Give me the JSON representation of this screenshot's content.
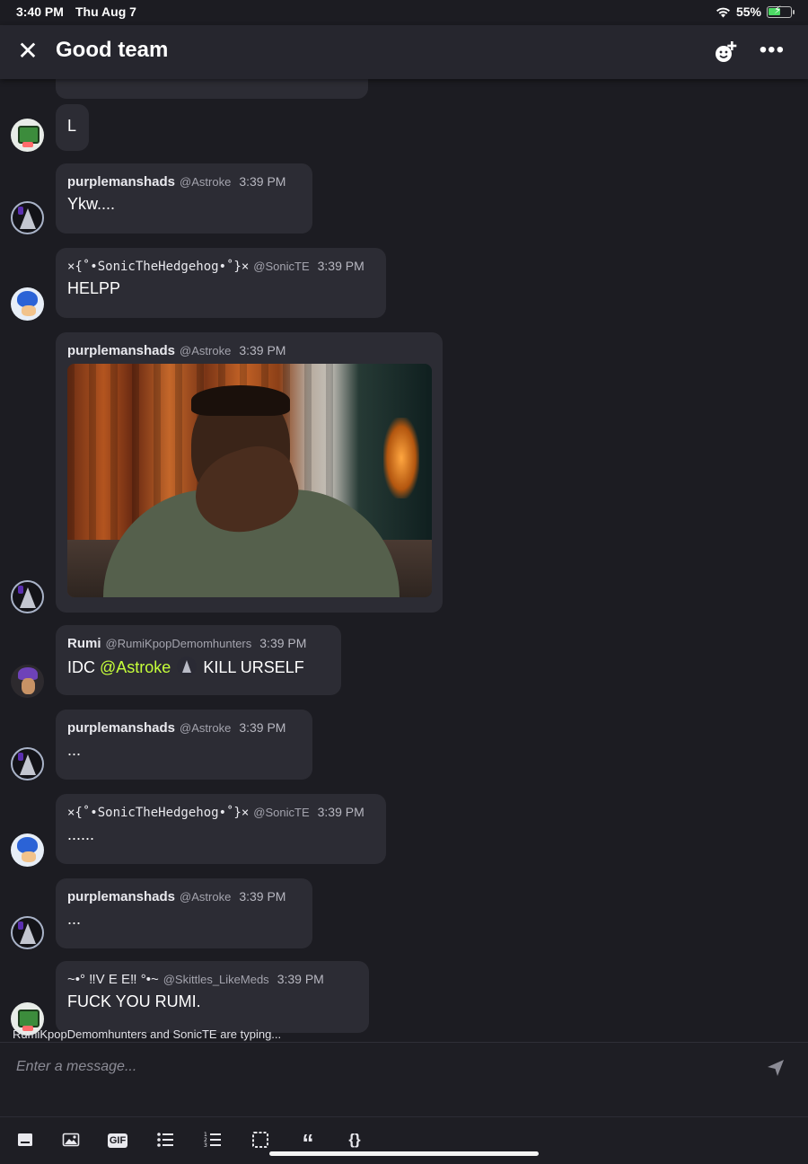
{
  "status": {
    "time": "3:40 PM",
    "date": "Thu Aug 7",
    "battery": "55%"
  },
  "header": {
    "title": "Good team",
    "close_icon": "close-icon",
    "add_member_icon": "add-member-icon",
    "more_icon": "more-icon"
  },
  "messages": [
    {
      "text": "L"
    },
    {
      "name": "purplemanshads",
      "handle": "@Astroke",
      "time": "3:39 PM",
      "text": "Ykw...."
    },
    {
      "name": "×{˚•SonicTheHedgehog•˚}×",
      "handle": "@SonicTE",
      "time": "3:39 PM",
      "text": "HELPP"
    },
    {
      "name": "purplemanshads",
      "handle": "@Astroke",
      "time": "3:39 PM"
    },
    {
      "name": "Rumi",
      "handle": "@RumiKpopDemomhunters",
      "time": "3:39 PM",
      "text_before": "IDC",
      "mention": "@Astroke",
      "text_after": "KILL URSELF"
    },
    {
      "name": "purplemanshads",
      "handle": "@Astroke",
      "time": "3:39 PM",
      "text": "..."
    },
    {
      "name": "×{˚•SonicTheHedgehog•˚}×",
      "handle": "@SonicTE",
      "time": "3:39 PM",
      "text": "......"
    },
    {
      "name": "purplemanshads",
      "handle": "@Astroke",
      "time": "3:39 PM",
      "text": "..."
    },
    {
      "name": "~•° ‼V E E‼ °•~",
      "handle": "@Skittles_LikeMeds",
      "time": "3:39 PM",
      "text": "FUCK YOU RUMI."
    }
  ],
  "typing_indicator": "RumiKpopDemomhunters and SonicTE are typing...",
  "composer": {
    "placeholder": "Enter a message..."
  },
  "toolbar": {
    "gif_label": "GIF",
    "quote_label": "“",
    "code_label": "{}"
  },
  "colors": {
    "background": "#1c1c22",
    "bubble": "#2c2c34",
    "mention": "#c6ff3a",
    "header": "#26262e"
  }
}
